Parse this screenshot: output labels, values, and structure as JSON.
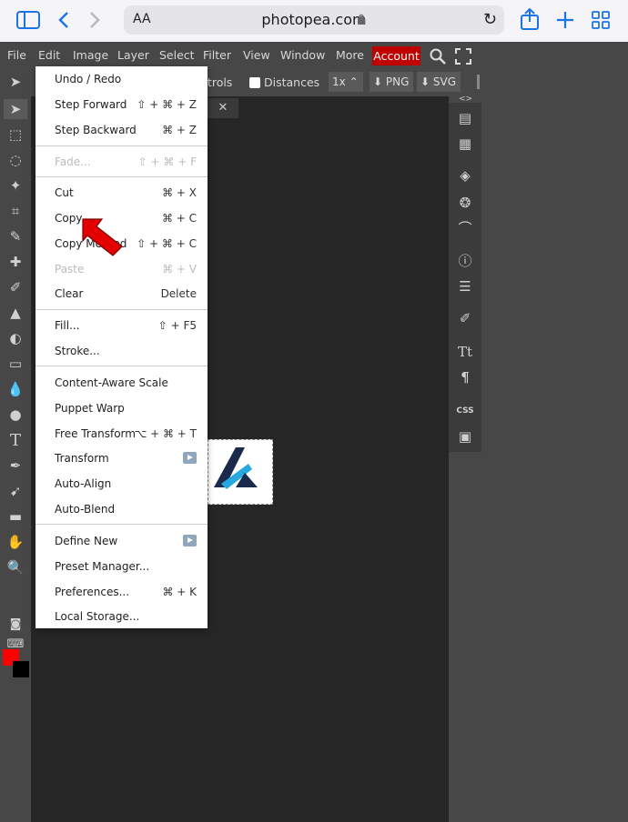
{
  "browser": {
    "text_size_button": "AA",
    "address": "photopea.com"
  },
  "menubar": {
    "items": [
      "File",
      "Edit",
      "Image",
      "Layer",
      "Select",
      "Filter",
      "View",
      "Window",
      "More"
    ],
    "account": "Account"
  },
  "options_bar": {
    "controls_partial": "ntrols",
    "distances_label": "Distances",
    "zoom": "1x",
    "png": "PNG",
    "svg": "SVG"
  },
  "document": {
    "close_label": "✕"
  },
  "edit_menu": {
    "items": [
      {
        "label": "Undo / Redo",
        "shortcut": ""
      },
      {
        "label": "Step Forward",
        "shortcut": "⇧ + ⌘ + Z"
      },
      {
        "label": "Step Backward",
        "shortcut": "⌘ + Z"
      },
      {
        "label": "Fade...",
        "shortcut": "⇧ + ⌘ + F",
        "disabled": true
      },
      {
        "label": "Cut",
        "shortcut": "⌘ + X"
      },
      {
        "label": "Copy",
        "shortcut": "⌘ + C"
      },
      {
        "label": "Copy Merged",
        "shortcut": "⇧ + ⌘ + C"
      },
      {
        "label": "Paste",
        "shortcut": "⌘ + V",
        "disabled": true
      },
      {
        "label": "Clear",
        "shortcut": "Delete"
      },
      {
        "label": "Fill...",
        "shortcut": "⇧ + F5"
      },
      {
        "label": "Stroke...",
        "shortcut": ""
      },
      {
        "label": "Content-Aware Scale",
        "shortcut": ""
      },
      {
        "label": "Puppet Warp",
        "shortcut": ""
      },
      {
        "label": "Free Transform",
        "shortcut": "⌥ + ⌘ + T"
      },
      {
        "label": "Transform",
        "shortcut": "",
        "submenu": true
      },
      {
        "label": "Auto-Align",
        "shortcut": ""
      },
      {
        "label": "Auto-Blend",
        "shortcut": ""
      },
      {
        "label": "Define New",
        "shortcut": "",
        "submenu": true
      },
      {
        "label": "Preset Manager...",
        "shortcut": ""
      },
      {
        "label": "Preferences...",
        "shortcut": "⌘ + K"
      },
      {
        "label": "Local Storage...",
        "shortcut": ""
      }
    ]
  },
  "right_panel": {
    "css_label": "CSS"
  },
  "colors": {
    "foreground": "#ff0000",
    "background": "#000000",
    "account_bg": "#c00000",
    "arrow": "#e30000"
  }
}
